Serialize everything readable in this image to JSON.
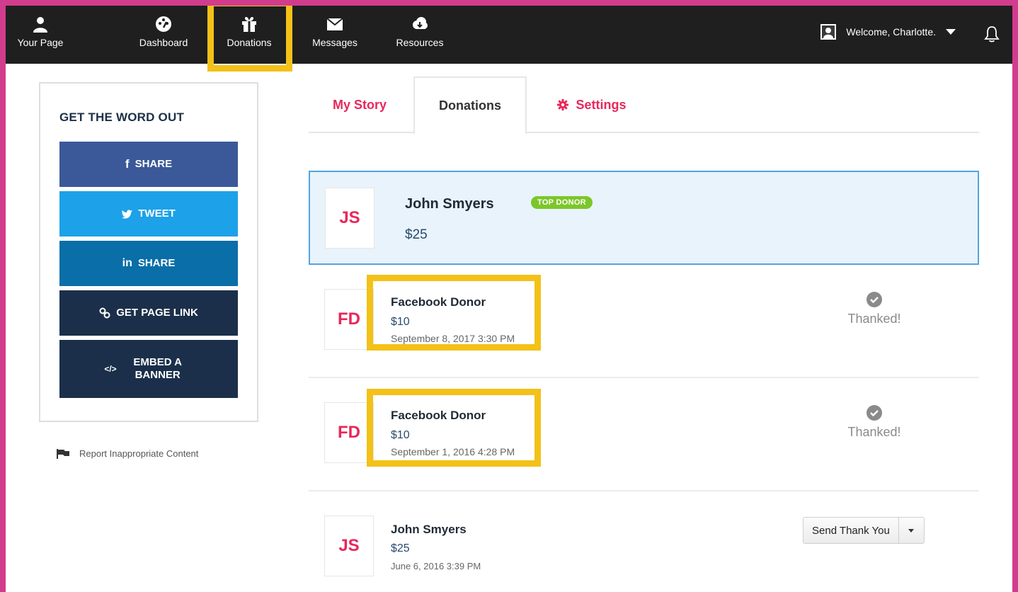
{
  "nav": {
    "items": [
      {
        "label": "Your Page",
        "icon": "user-icon"
      },
      {
        "label": "Dashboard",
        "icon": "dashboard-icon"
      },
      {
        "label": "Donations",
        "icon": "gift-icon"
      },
      {
        "label": "Messages",
        "icon": "envelope-icon"
      },
      {
        "label": "Resources",
        "icon": "cloud-download-icon"
      }
    ],
    "welcome": "Welcome, Charlotte."
  },
  "sidebar": {
    "title": "GET THE WORD OUT",
    "buttons": [
      {
        "label": "SHARE",
        "icon": "facebook-icon",
        "color": "#3b5998"
      },
      {
        "label": "TWEET",
        "icon": "twitter-icon",
        "color": "#1da1e8"
      },
      {
        "label": "SHARE",
        "icon": "linkedin-icon",
        "color": "#0a6ea8"
      },
      {
        "label": "GET PAGE LINK",
        "icon": "link-icon",
        "color": "#1b2f4a"
      },
      {
        "label": "EMBED A BANNER",
        "icon": "code-icon",
        "color": "#1b2f4a"
      }
    ],
    "report": "Report Inappropriate Content"
  },
  "tabs": [
    {
      "label": "My Story"
    },
    {
      "label": "Donations"
    },
    {
      "label": "Settings"
    }
  ],
  "donations": {
    "top": {
      "initials": "JS",
      "name": "John Smyers",
      "badge": "TOP DONOR",
      "amount": "$25"
    },
    "rows": [
      {
        "initials": "FD",
        "name": "Facebook Donor",
        "amount": "$10",
        "date": "September 8, 2017 3:30 PM",
        "status": "Thanked!"
      },
      {
        "initials": "FD",
        "name": "Facebook Donor",
        "amount": "$10",
        "date": "September 1, 2016 4:28 PM",
        "status": "Thanked!"
      },
      {
        "initials": "JS",
        "name": "John Smyers",
        "amount": "$25",
        "date": "June 6, 2016 3:39 PM",
        "action": "Send Thank You"
      }
    ]
  },
  "colors": {
    "accent": "#e8275a",
    "highlight": "#f3c118",
    "frame": "#d23c8c",
    "top_donor_badge": "#7cc62a"
  }
}
